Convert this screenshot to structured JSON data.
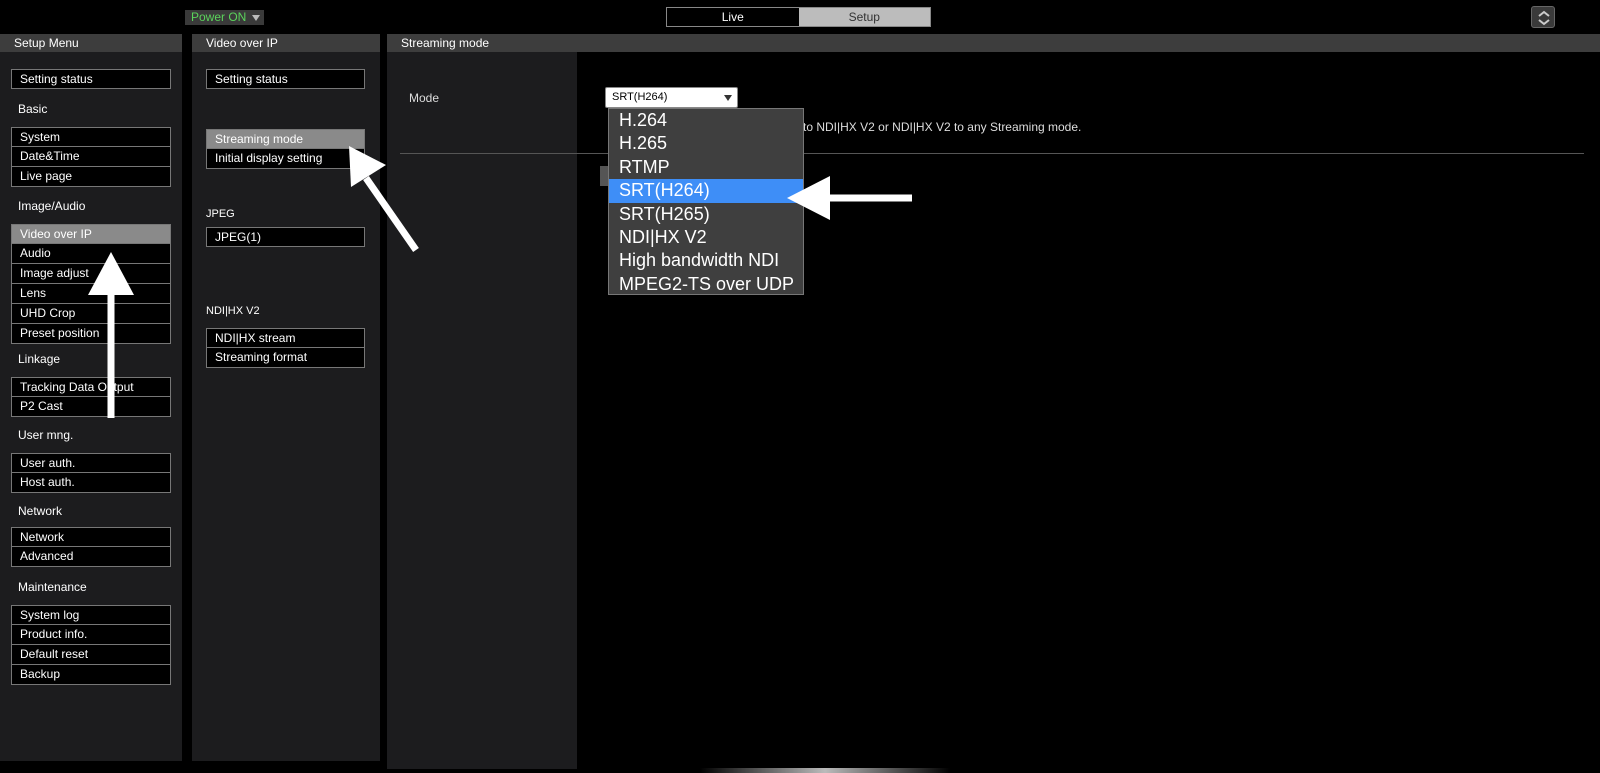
{
  "topbar": {
    "power_label": "Power ON",
    "tabs": [
      {
        "label": "Live",
        "active": false
      },
      {
        "label": "Setup",
        "active": true
      }
    ],
    "scroll_icon": "up-down-chevron-icon"
  },
  "left_panel": {
    "title": "Setup Menu",
    "setting_status": "Setting status",
    "sections": [
      {
        "title": "Basic",
        "items": [
          "System",
          "Date&Time",
          "Live page"
        ]
      },
      {
        "title": "Image/Audio",
        "items": [
          "Video over IP",
          "Audio",
          "Image adjust",
          "Lens",
          "UHD Crop",
          "Preset position"
        ]
      },
      {
        "title": "Linkage",
        "items": [
          "Tracking Data Output",
          "P2 Cast"
        ]
      },
      {
        "title": "User mng.",
        "items": [
          "User auth.",
          "Host auth."
        ]
      },
      {
        "title": "Network",
        "items": [
          "Network",
          "Advanced"
        ]
      },
      {
        "title": "Maintenance",
        "items": [
          "System log",
          "Product info.",
          "Default reset",
          "Backup"
        ]
      }
    ],
    "active_item": "Video over IP"
  },
  "mid_panel": {
    "title": "Video over IP",
    "setting_status": "Setting status",
    "streaming_items": [
      "Streaming mode",
      "Initial display setting"
    ],
    "jpeg_title": "JPEG",
    "jpeg_items": [
      "JPEG(1)"
    ],
    "ndi_title": "NDI|HX V2",
    "ndi_items": [
      "NDI|HX stream",
      "Streaming format"
    ],
    "active_item": "Streaming mode"
  },
  "right_panel": {
    "title": "Streaming mode",
    "mode_label": "Mode",
    "selected_value": "SRT(H264)",
    "note": "e to NDI|HX V2 or NDI|HX V2 to any Streaming mode.",
    "options": [
      "H.264",
      "H.265",
      "RTMP",
      "SRT(H264)",
      "SRT(H265)",
      "NDI|HX V2",
      "High bandwidth NDI",
      "MPEG2-TS over UDP"
    ],
    "highlighted_option": "SRT(H264)"
  },
  "colors": {
    "accent": "#3e8ef7",
    "power_on": "#5bd35b",
    "active_nav": "#8a8a8a"
  }
}
